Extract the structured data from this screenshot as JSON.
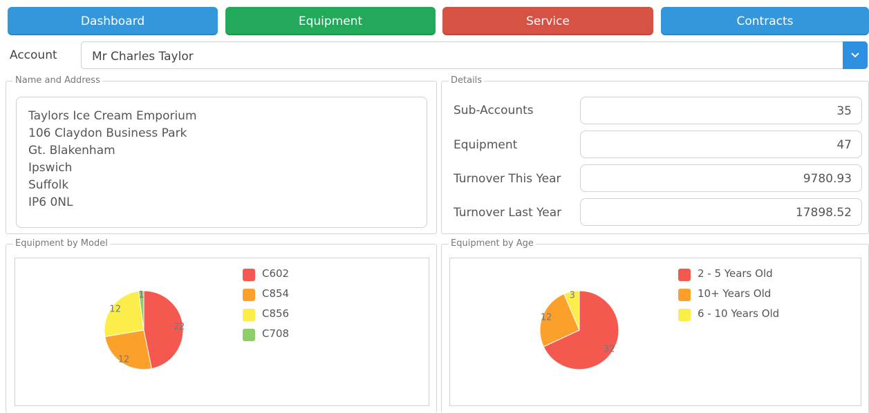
{
  "nav": {
    "dashboard": {
      "label": "Dashboard",
      "color": "#3597db"
    },
    "equipment": {
      "label": "Equipment",
      "color": "#22a95a"
    },
    "service": {
      "label": "Service",
      "color": "#d65244"
    },
    "contracts": {
      "label": "Contracts",
      "color": "#3597db"
    }
  },
  "account": {
    "label": "Account",
    "value": "Mr Charles Taylor"
  },
  "name_address": {
    "title": "Name and Address",
    "lines": [
      "Taylors Ice Cream Emporium",
      "106 Claydon Business Park",
      "Gt. Blakenham",
      "Ipswich",
      "Suffolk",
      "IP6 0NL"
    ]
  },
  "details": {
    "title": "Details",
    "rows": [
      {
        "label": "Sub-Accounts",
        "value": "35"
      },
      {
        "label": "Equipment",
        "value": "47"
      },
      {
        "label": "Turnover This Year",
        "value": "9780.93"
      },
      {
        "label": "Turnover Last Year",
        "value": "17898.52"
      }
    ]
  },
  "equipment_by_model": {
    "title": "Equipment by Model"
  },
  "equipment_by_age": {
    "title": "Equipment by Age"
  },
  "chart_data": [
    {
      "type": "pie",
      "categories": [
        "C602",
        "C854",
        "C856",
        "C708"
      ],
      "values": [
        22,
        12,
        12,
        1
      ],
      "colors": [
        "#f4584e",
        "#fba02a",
        "#fbed4a",
        "#8fcc6a"
      ],
      "legend": "right"
    },
    {
      "type": "pie",
      "categories": [
        "2 - 5 Years Old",
        "10+ Years Old",
        "6 - 10 Years Old"
      ],
      "values": [
        32,
        12,
        3
      ],
      "colors": [
        "#f4584e",
        "#fba02a",
        "#fbed4a"
      ],
      "legend": "right"
    }
  ]
}
